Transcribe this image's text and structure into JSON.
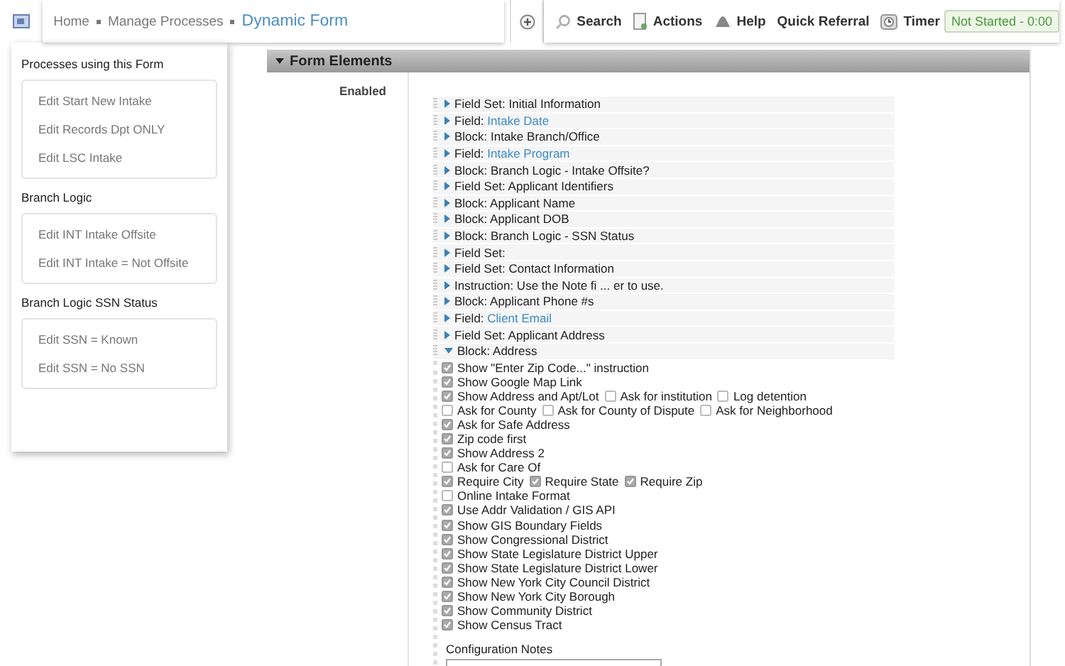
{
  "breadcrumb": {
    "items": [
      "Home",
      "Manage Processes"
    ],
    "current": "Dynamic Form"
  },
  "toolbar": {
    "items": [
      {
        "kind": "search",
        "label": "Search"
      },
      {
        "kind": "actions",
        "label": "Actions"
      },
      {
        "kind": "help",
        "label": "Help"
      },
      {
        "kind": "plain",
        "label": "Quick Referral"
      },
      {
        "kind": "timer",
        "label": "Timer"
      }
    ],
    "timer_status": "Not Started - 0:00"
  },
  "sidebar": {
    "sections": [
      {
        "title": "Processes using this Form",
        "items": [
          "Edit Start New Intake",
          "Edit Records Dpt ONLY",
          "Edit LSC Intake"
        ]
      },
      {
        "title": "Branch Logic",
        "items": [
          "Edit INT Intake Offsite",
          "Edit INT Intake = Not Offsite"
        ]
      },
      {
        "title": "Branch Logic SSN Status",
        "items": [
          "Edit SSN = Known",
          "Edit SSN = No SSN"
        ]
      }
    ]
  },
  "panel": {
    "title": "Form Elements",
    "expanded": true,
    "row_label": "Enabled",
    "elements": [
      {
        "label": "Field Set: Initial Information",
        "expanded": false
      },
      {
        "label": "Field: ",
        "link": "Intake Date",
        "expanded": false
      },
      {
        "label": "Block: Intake Branch/Office",
        "expanded": false
      },
      {
        "label": "Field: ",
        "link": "Intake Program",
        "expanded": false
      },
      {
        "label": "Block: Branch Logic - Intake Offsite?",
        "expanded": false
      },
      {
        "label": "Field Set: Applicant Identifiers",
        "expanded": false
      },
      {
        "label": "Block: Applicant Name",
        "expanded": false
      },
      {
        "label": "Block: Applicant DOB",
        "expanded": false
      },
      {
        "label": "Block: Branch Logic - SSN Status",
        "expanded": false
      },
      {
        "label": "Field Set:",
        "expanded": false
      },
      {
        "label": "Field Set: Contact Information",
        "expanded": false
      },
      {
        "label": "Instruction: Use the Note fi ... er to use.",
        "expanded": false
      },
      {
        "label": "Block: Applicant Phone #s",
        "expanded": false
      },
      {
        "label": "Field: ",
        "link": "Client Email",
        "expanded": false
      },
      {
        "label": "Field Set: Applicant Address",
        "expanded": false
      },
      {
        "label": "Block: Address",
        "expanded": true,
        "options": [
          [
            {
              "label": "Show \"Enter Zip Code...\" instruction",
              "checked": true
            }
          ],
          [
            {
              "label": "Show Google Map Link",
              "checked": true
            }
          ],
          [
            {
              "label": "Show Address and Apt/Lot",
              "checked": true
            },
            {
              "label": "Ask for institution",
              "checked": false
            },
            {
              "label": "Log detention",
              "checked": false
            }
          ],
          [
            {
              "label": "Ask for County",
              "checked": false
            },
            {
              "label": "Ask for County of Dispute",
              "checked": false
            },
            {
              "label": "Ask for Neighborhood",
              "checked": false
            }
          ],
          [
            {
              "label": "Ask for Safe Address",
              "checked": true
            }
          ],
          [
            {
              "label": "Zip code first",
              "checked": true
            }
          ],
          [
            {
              "label": "Show Address 2",
              "checked": true
            }
          ],
          [
            {
              "label": "Ask for Care Of",
              "checked": false
            }
          ],
          [
            {
              "label": "Require City",
              "checked": true
            },
            {
              "label": "Require State",
              "checked": true
            },
            {
              "label": "Require Zip",
              "checked": true
            }
          ],
          [
            {
              "label": "Online Intake Format",
              "checked": false
            }
          ],
          [
            {
              "label": "Use Addr Validation / GIS API",
              "checked": true
            }
          ],
          [
            {
              "label": "Show GIS Boundary Fields",
              "checked": true
            }
          ],
          [
            {
              "label": "Show Congressional District",
              "checked": true
            }
          ],
          [
            {
              "label": "Show State Legislature District Upper",
              "checked": true
            }
          ],
          [
            {
              "label": "Show State Legislature District Lower",
              "checked": true
            }
          ],
          [
            {
              "label": "Show New York City Council District",
              "checked": true
            }
          ],
          [
            {
              "label": "Show New York City Borough",
              "checked": true
            }
          ],
          [
            {
              "label": "Show Community District",
              "checked": true
            }
          ],
          [
            {
              "label": "Show Census Tract",
              "checked": true
            }
          ]
        ],
        "notes_label": "Configuration Notes"
      }
    ]
  }
}
